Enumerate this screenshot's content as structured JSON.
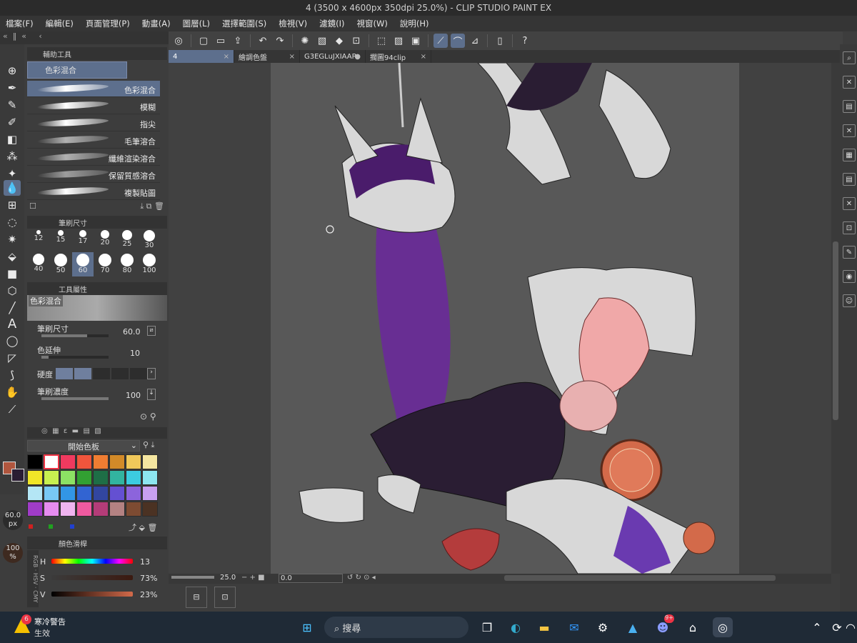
{
  "window": {
    "title": "4 (3500 x 4600px 350dpi 25.0%) - CLIP STUDIO PAINT EX"
  },
  "menu": [
    "檔案(F)",
    "編輯(E)",
    "頁面管理(P)",
    "動畫(A)",
    "圖層(L)",
    "選擇範圍(S)",
    "檢視(V)",
    "濾鏡(I)",
    "視窗(W)",
    "說明(H)"
  ],
  "tabs": [
    {
      "label": "4",
      "active": true,
      "close": "×"
    },
    {
      "label": "繪調色盤",
      "active": false,
      "close": "×"
    },
    {
      "label": "G3EGLuJXIAAP",
      "active": false,
      "close": "●"
    },
    {
      "label": "擱圖94clip",
      "active": false,
      "close": "×"
    }
  ],
  "sub_tool_panel": {
    "header": "輔助工具",
    "group": "色彩混合",
    "items": [
      "色彩混合",
      "模糊",
      "指尖",
      "毛筆溶合",
      "纖維渲染溶合",
      "保留質感溶合",
      "複製貼圖"
    ]
  },
  "brush_size_panel": {
    "header": "筆刷尺寸",
    "sizes": [
      "12",
      "15",
      "17",
      "20",
      "25",
      "30",
      "40",
      "50",
      "60",
      "70",
      "80",
      "100"
    ],
    "selected": "60"
  },
  "tool_property": {
    "header": "工具屬性",
    "preview_label": "色彩混合",
    "rows": [
      {
        "label": "筆刷尺寸",
        "value": "60.0"
      },
      {
        "label": "色延伸",
        "value": "10"
      },
      {
        "label": "硬度",
        "value": ""
      },
      {
        "label": "筆刷濃度",
        "value": "100"
      }
    ]
  },
  "palette": {
    "name": "開始色板",
    "colors": [
      "#000000",
      "#ffffff",
      "#f03a5f",
      "#f0553c",
      "#f07d32",
      "#d28a28",
      "#f0c85a",
      "#f5e6a0",
      "#f0e628",
      "#c8f050",
      "#8ce164",
      "#32a032",
      "#1e6e46",
      "#32b4a0",
      "#3ccce0",
      "#8ce6f0",
      "#b4e6f5",
      "#78c8f5",
      "#3296e6",
      "#3264d2",
      "#3246a0",
      "#6450d2",
      "#8c64dc",
      "#c8a0f0",
      "#a03cc8",
      "#e68cf0",
      "#f0b4f0",
      "#f05aa0",
      "#b43c78",
      "#b48282",
      "#7d4b32",
      "#4b3223"
    ]
  },
  "color_slider": {
    "header": "顏色滑桿",
    "rows": [
      {
        "label": "H",
        "value": "13"
      },
      {
        "label": "S",
        "value": "73%"
      },
      {
        "label": "V",
        "value": "23%"
      }
    ],
    "modes": [
      "RGB",
      "HSV",
      "CMY"
    ]
  },
  "colors": {
    "main": "#b0563e",
    "sub": "#2a1d33",
    "accent": "#5d6f8d"
  },
  "left_readouts": {
    "brush_size": "60.0",
    "brush_size_unit": "px",
    "opacity": "100",
    "opacity_unit": "%"
  },
  "statusbar": {
    "zoom": "25.0",
    "angle": "0.0"
  },
  "taskbar": {
    "weather_badge": "6",
    "weather_title": "寒冷警告",
    "weather_sub": "生效",
    "search_placeholder": "搜尋",
    "discord_badge": "9+"
  }
}
